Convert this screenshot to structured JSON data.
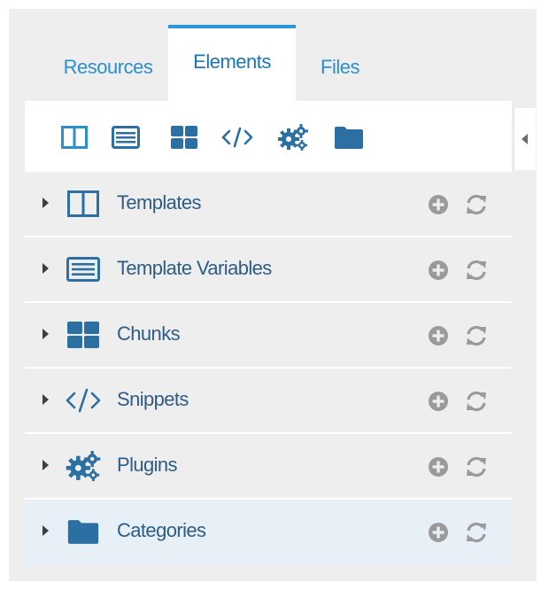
{
  "tabs": [
    {
      "label": "Resources",
      "active": false
    },
    {
      "label": "Elements",
      "active": true
    },
    {
      "label": "Files",
      "active": false
    }
  ],
  "toolbar": {
    "icons": [
      "templates-icon",
      "template-variables-icon",
      "chunks-icon",
      "snippets-icon",
      "plugins-icon",
      "categories-icon"
    ]
  },
  "tree": {
    "items": [
      {
        "label": "Templates",
        "icon": "templates-icon"
      },
      {
        "label": "Template Variables",
        "icon": "template-variables-icon"
      },
      {
        "label": "Chunks",
        "icon": "chunks-icon"
      },
      {
        "label": "Snippets",
        "icon": "snippets-icon"
      },
      {
        "label": "Plugins",
        "icon": "plugins-icon"
      },
      {
        "label": "Categories",
        "icon": "categories-icon",
        "selected": true
      }
    ]
  },
  "colors": {
    "accent": "#2b95d6",
    "tab_text": "#2b8fcf",
    "icon": "#2b6fa3",
    "row_label": "#2f5c84",
    "action_icon": "#9a9a9a",
    "selected_row": "#e7eff7"
  }
}
